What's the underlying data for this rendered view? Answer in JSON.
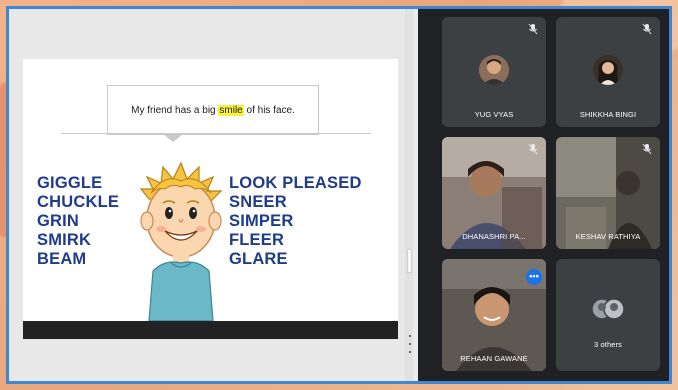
{
  "slide": {
    "callout_before": "My friend has a big ",
    "callout_highlight": "smile",
    "callout_after": " of his face.",
    "left_words": [
      "GIGGLE",
      "CHUCKLE",
      "GRIN",
      "SMIRK",
      "BEAM"
    ],
    "right_words": [
      "LOOK PLEASED",
      "SNEER",
      "SIMPER",
      "FLEER",
      "GLARE"
    ]
  },
  "participants": [
    {
      "name": "YUG VYAS",
      "muted": true,
      "type": "avatar"
    },
    {
      "name": "SHIKKHA BINGI",
      "muted": true,
      "type": "avatar"
    },
    {
      "name": "DHANASHRI PA...",
      "muted": true,
      "type": "video"
    },
    {
      "name": "KESHAV RATHIYA",
      "muted": true,
      "type": "video"
    },
    {
      "name": "REHAAN GAWANE",
      "muted": false,
      "type": "video"
    },
    {
      "name": "3 others",
      "muted": false,
      "type": "group"
    }
  ],
  "colors": {
    "frame": "#3f86d3",
    "word_color": "#1f3c8a",
    "highlight": "#f7f33a",
    "panel": "#202124",
    "tile": "#3c4043"
  },
  "icons": {
    "mic_off": "mic-off-icon",
    "more": "more-options-icon"
  }
}
